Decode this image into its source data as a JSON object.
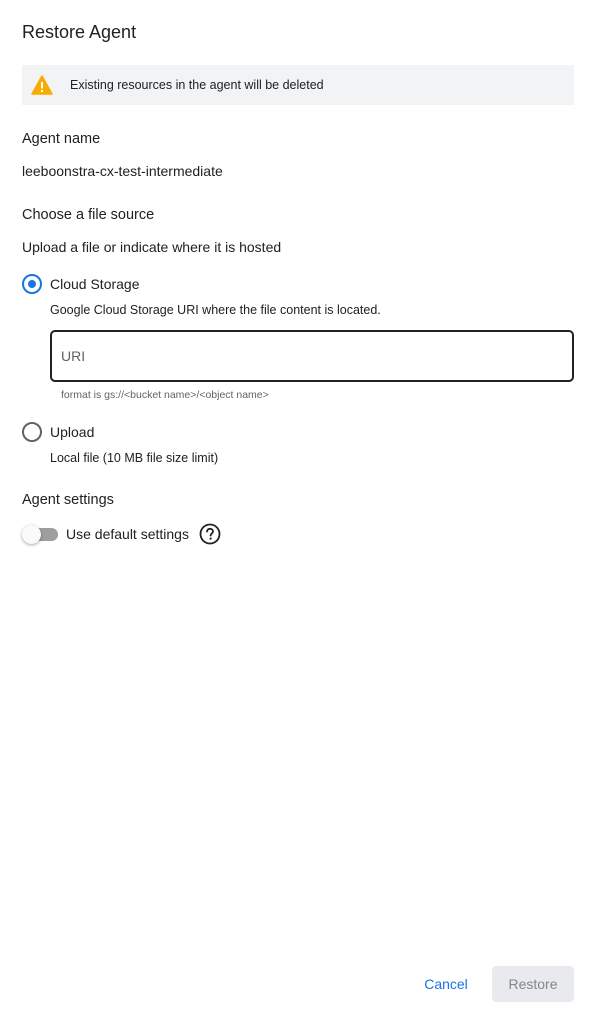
{
  "dialog": {
    "title": "Restore Agent"
  },
  "warning": {
    "icon": "warning-icon",
    "color": "#f9ab00",
    "text": "Existing resources in the agent will be deleted"
  },
  "agent_name": {
    "label": "Agent name",
    "value": "leeboonstra-cx-test-intermediate"
  },
  "file_source": {
    "label": "Choose a file source",
    "description": "Upload a file or indicate where it is hosted",
    "options": [
      {
        "label": "Cloud Storage",
        "description": "Google Cloud Storage URI where the file content is located.",
        "selected": true
      },
      {
        "label": "Upload",
        "description": "Local file (10 MB file size limit)",
        "selected": false
      }
    ],
    "uri_input": {
      "placeholder": "URI",
      "value": "",
      "hint": "format is gs://<bucket name>/<object name>"
    }
  },
  "agent_settings": {
    "label": "Agent settings",
    "toggle_label": "Use default settings",
    "toggle_on": false,
    "help_icon": "help-circle-icon"
  },
  "actions": {
    "cancel_label": "Cancel",
    "restore_label": "Restore",
    "restore_enabled": false
  },
  "colors": {
    "accent": "#1a73e8",
    "text": "#202124",
    "banner_bg": "#f1f3f4",
    "disabled_bg": "#e8eaed"
  }
}
